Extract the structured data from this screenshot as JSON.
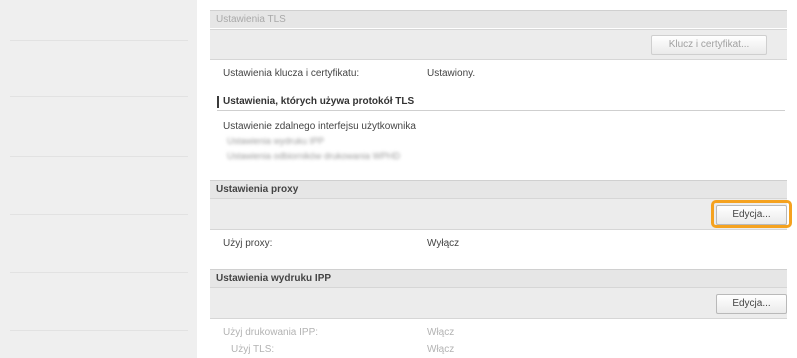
{
  "tls_section": {
    "header": "Ustawienia TLS",
    "key_cert_button": "Klucz i certyfikat...",
    "key_cert_label": "Ustawienia klucza i certyfikatu:",
    "key_cert_value": "Ustawiony.",
    "using_tls_heading": "Ustawienia, których używa protokół TLS",
    "remote_ui_label": "Ustawienie zdalnego interfejsu użytkownika",
    "blurred_item_1": "Ustawienia wydruku IPP",
    "blurred_item_2": "Ustawienia odbiorników drukowania WPHD"
  },
  "proxy_section": {
    "header": "Ustawienia proxy",
    "edit_button": "Edycja...",
    "use_proxy_label": "Użyj proxy:",
    "use_proxy_value": "Wyłącz"
  },
  "ipp_section": {
    "header": "Ustawienia wydruku IPP",
    "edit_button": "Edycja...",
    "use_ipp_label": "Użyj drukowania IPP:",
    "use_ipp_value": "Włącz",
    "use_tls_label": "Użyj TLS:",
    "use_tls_value": "Włącz"
  },
  "colors": {
    "highlight": "#f5a21f",
    "sidebar_bg": "#efefef",
    "header_bg": "#e6e6e6"
  }
}
